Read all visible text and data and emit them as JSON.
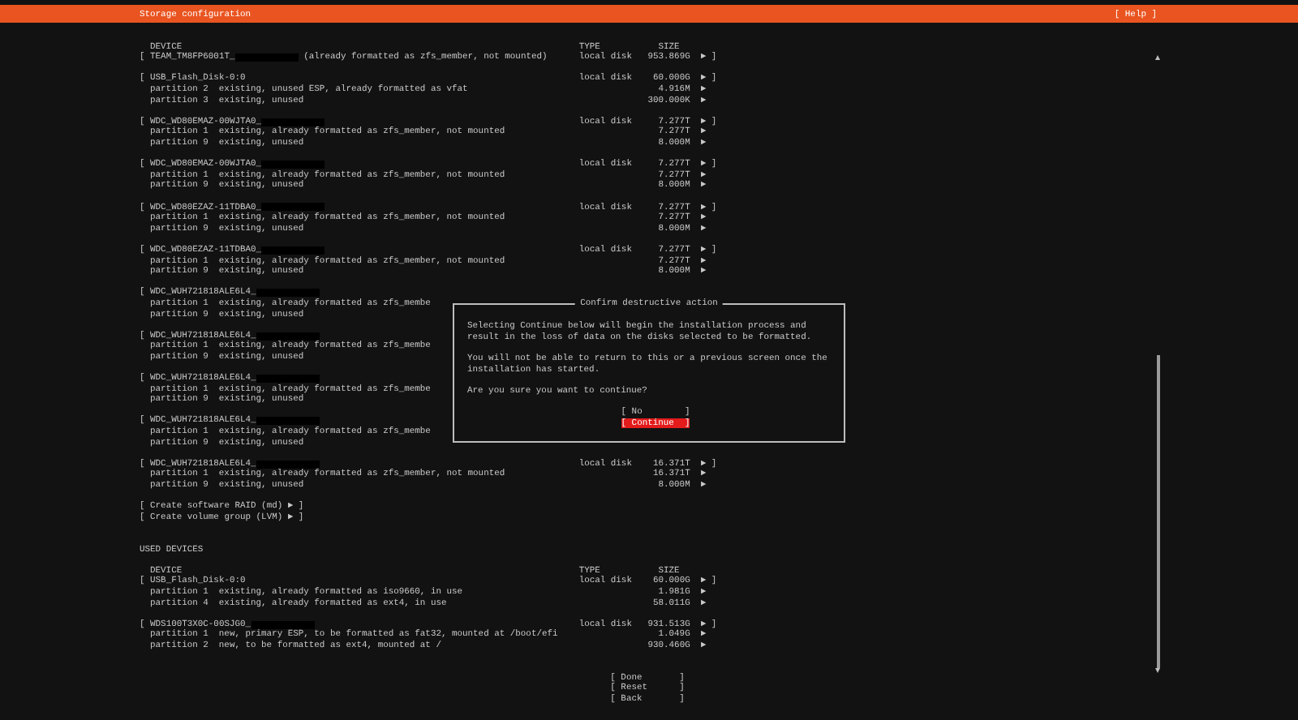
{
  "header": {
    "title": "Storage configuration",
    "help_button": "[ Help ]"
  },
  "available": {
    "columns": [
      "DEVICE",
      "TYPE",
      "SIZE"
    ],
    "disks": [
      {
        "name": "[ TEAM_TM8FP6001T_",
        "redacted": true,
        "note": "(already formatted as zfs_member, not mounted)",
        "type": "local disk",
        "size": "953.869G",
        "action": "► ]"
      },
      {
        "name": "[ USB_Flash_Disk-0:0",
        "redacted": false,
        "type": "local disk",
        "size": "60.000G",
        "action": "► ]",
        "partitions": [
          {
            "name": "partition 2",
            "desc": "existing, unused ESP, already formatted as vfat",
            "size": "4.916M",
            "action": "►"
          },
          {
            "name": "partition 3",
            "desc": "existing, unused",
            "size": "300.000K",
            "action": "►"
          }
        ]
      },
      {
        "name": "[ WDC_WD80EMAZ-00WJTA0_",
        "redacted": true,
        "type": "local disk",
        "size": "7.277T",
        "action": "► ]",
        "partitions": [
          {
            "name": "partition 1",
            "desc": "existing, already formatted as zfs_member, not mounted",
            "size": "7.277T",
            "action": "►"
          },
          {
            "name": "partition 9",
            "desc": "existing, unused",
            "size": "8.000M",
            "action": "►"
          }
        ]
      },
      {
        "name": "[ WDC_WD80EMAZ-00WJTA0_",
        "redacted": true,
        "type": "local disk",
        "size": "7.277T",
        "action": "► ]",
        "partitions": [
          {
            "name": "partition 1",
            "desc": "existing, already formatted as zfs_member, not mounted",
            "size": "7.277T",
            "action": "►"
          },
          {
            "name": "partition 9",
            "desc": "existing, unused",
            "size": "8.000M",
            "action": "►"
          }
        ]
      },
      {
        "name": "[ WDC_WD80EZAZ-11TDBA0_",
        "redacted": true,
        "type": "local disk",
        "size": "7.277T",
        "action": "► ]",
        "partitions": [
          {
            "name": "partition 1",
            "desc": "existing, already formatted as zfs_member, not mounted",
            "size": "7.277T",
            "action": "►"
          },
          {
            "name": "partition 9",
            "desc": "existing, unused",
            "size": "8.000M",
            "action": "►"
          }
        ]
      },
      {
        "name": "[ WDC_WD80EZAZ-11TDBA0_",
        "redacted": true,
        "type": "local disk",
        "size": "7.277T",
        "action": "► ]",
        "partitions": [
          {
            "name": "partition 1",
            "desc": "existing, already formatted as zfs_member, not mounted",
            "size": "7.277T",
            "action": "►"
          },
          {
            "name": "partition 9",
            "desc": "existing, unused",
            "size": "8.000M",
            "action": "►"
          }
        ]
      },
      {
        "name": "[ WDC_WUH721818ALE6L4_",
        "redacted": true,
        "partitions": [
          {
            "name": "partition 1",
            "desc": "existing, already formatted as zfs_membe"
          },
          {
            "name": "partition 9",
            "desc": "existing, unused"
          }
        ]
      },
      {
        "name": "[ WDC_WUH721818ALE6L4_",
        "redacted": true,
        "partitions": [
          {
            "name": "partition 1",
            "desc": "existing, already formatted as zfs_membe"
          },
          {
            "name": "partition 9",
            "desc": "existing, unused"
          }
        ]
      },
      {
        "name": "[ WDC_WUH721818ALE6L4_",
        "redacted": true,
        "partitions": [
          {
            "name": "partition 1",
            "desc": "existing, already formatted as zfs_membe"
          },
          {
            "name": "partition 9",
            "desc": "existing, unused"
          }
        ]
      },
      {
        "name": "[ WDC_WUH721818ALE6L4_",
        "redacted": true,
        "partitions": [
          {
            "name": "partition 1",
            "desc": "existing, already formatted as zfs_membe"
          },
          {
            "name": "partition 9",
            "desc": "existing, unused"
          }
        ]
      },
      {
        "name": "[ WDC_WUH721818ALE6L4_",
        "redacted": true,
        "type": "local disk",
        "size": "16.371T",
        "action": "► ]",
        "partitions": [
          {
            "name": "partition 1",
            "desc": "existing, already formatted as zfs_member, not mounted",
            "size": "16.371T",
            "action": "►"
          },
          {
            "name": "partition 9",
            "desc": "existing, unused",
            "size": "8.000M",
            "action": "►"
          }
        ]
      }
    ],
    "actions": [
      "[ Create software RAID (md) ► ]",
      "[ Create volume group (LVM) ► ]"
    ]
  },
  "used": {
    "title": "USED DEVICES",
    "columns": [
      "DEVICE",
      "TYPE",
      "SIZE"
    ],
    "disks": [
      {
        "name": "[ USB_Flash_Disk-0:0",
        "redacted": false,
        "type": "local disk",
        "size": "60.000G",
        "action": "► ]",
        "partitions": [
          {
            "name": "partition 1",
            "desc": "existing, already formatted as iso9660, in use",
            "size": "1.981G",
            "action": "►"
          },
          {
            "name": "partition 4",
            "desc": "existing, already formatted as ext4, in use",
            "size": "58.011G",
            "action": "►"
          }
        ]
      },
      {
        "name": "[ WDS100T3X0C-00SJG0_",
        "redacted": true,
        "type": "local disk",
        "size": "931.513G",
        "action": "► ]",
        "partitions": [
          {
            "name": "partition 1",
            "desc": "new, primary ESP, to be formatted as fat32, mounted at /boot/efi",
            "size": "1.049G",
            "action": "►"
          },
          {
            "name": "partition 2",
            "desc": "new, to be formatted as ext4, mounted at /",
            "size": "930.460G",
            "action": "►"
          }
        ]
      }
    ]
  },
  "buttons": [
    {
      "label": "[ Done       ]"
    },
    {
      "label": "[ Reset      ]"
    },
    {
      "label": "[ Back       ]"
    }
  ],
  "dialog": {
    "title": "Confirm destructive action",
    "paragraphs": [
      "Selecting Continue below will begin the installation process and result in the loss of data on the disks selected to be formatted.",
      "You will not be able to return to this or a previous screen once the installation has started.",
      "Are you sure you want to continue?"
    ],
    "buttons": [
      {
        "label": "[ No        ]",
        "selected": false
      },
      {
        "label": "[ Continue  ]",
        "selected": true
      }
    ]
  }
}
